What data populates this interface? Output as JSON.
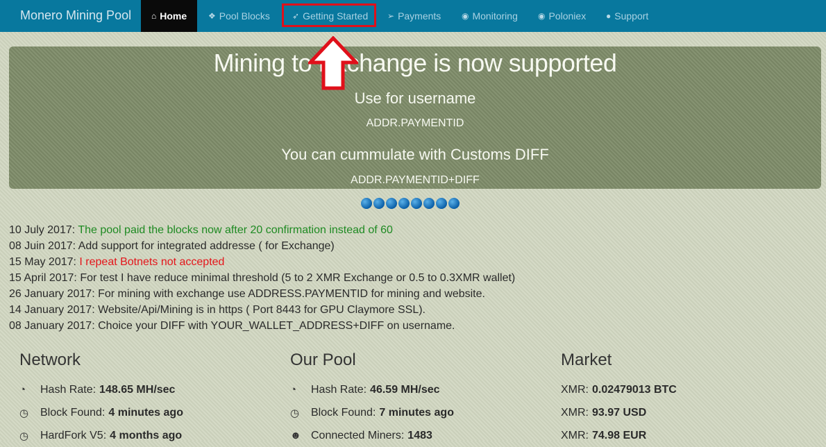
{
  "navbar": {
    "brand": "Monero Mining Pool",
    "items": [
      {
        "label": "Home",
        "icon": "home-icon",
        "glyph": "⌂"
      },
      {
        "label": "Pool Blocks",
        "icon": "cubes-icon",
        "glyph": "❖"
      },
      {
        "label": "Getting Started",
        "icon": "rocket-icon",
        "glyph": "➶"
      },
      {
        "label": "Payments",
        "icon": "send-icon",
        "glyph": "➢"
      },
      {
        "label": "Monitoring",
        "icon": "eye-icon",
        "glyph": "◉"
      },
      {
        "label": "Poloniex",
        "icon": "eye-icon",
        "glyph": "◉"
      },
      {
        "label": "Support",
        "icon": "comments-icon",
        "glyph": "●"
      }
    ],
    "active": "Home",
    "highlighted": "Getting Started"
  },
  "carousel": {
    "title": "Mining to Exchange is now supported",
    "line1": "Use for username",
    "code1": "ADDR.PAYMENTID",
    "line2": "You can cummulate with Customs DIFF",
    "code2": "ADDR.PAYMENTID+DIFF",
    "slide_count": 8
  },
  "news": [
    {
      "date": "10 July 2017:",
      "text": "The pool paid the blocks now after 20 confirmation instead of 60",
      "color": "#1e8a22"
    },
    {
      "date": "08 Juin 2017:",
      "text": "Add support for integrated addresse ( for Exchange)",
      "color": ""
    },
    {
      "date": "15 May 2017:",
      "text": "I repeat Botnets not accepted",
      "color": "#e4161b"
    },
    {
      "date": "15 April 2017:",
      "text": "For test I have reduce minimal threshold (5 to 2 XMR Exchange or 0.5 to 0.3XMR wallet)",
      "color": ""
    },
    {
      "date": "26 January 2017:",
      "text": "For mining with exchange use ADDRESS.PAYMENTID for mining and website.",
      "color": ""
    },
    {
      "date": "14 January 2017:",
      "text": "Website/Api/Mining is in https ( Port 8443 for GPU Claymore SSL).",
      "color": ""
    },
    {
      "date": "08 January 2017:",
      "text": "Choice your DIFF with YOUR_WALLET_ADDRESS+DIFF on username.",
      "color": ""
    }
  ],
  "network": {
    "title": "Network",
    "stats": [
      {
        "label": "Hash Rate:",
        "value": "148.65 MH/sec",
        "icon": "dashboard-icon"
      },
      {
        "label": "Block Found:",
        "value": "4 minutes ago",
        "icon": "clock-icon"
      },
      {
        "label": "HardFork V5:",
        "value": "4 months ago",
        "icon": "clock-icon"
      }
    ]
  },
  "pool": {
    "title": "Our Pool",
    "stats": [
      {
        "label": "Hash Rate:",
        "value": "46.59 MH/sec",
        "icon": "dashboard-icon"
      },
      {
        "label": "Block Found:",
        "value": "7 minutes ago",
        "icon": "clock-icon"
      },
      {
        "label": "Connected Miners:",
        "value": "1483",
        "icon": "users-icon"
      }
    ]
  },
  "market": {
    "title": "Market",
    "stats": [
      {
        "label": "XMR:",
        "value": "0.02479013 BTC"
      },
      {
        "label": "XMR:",
        "value": "93.97 USD"
      },
      {
        "label": "XMR:",
        "value": "74.98 EUR"
      }
    ]
  }
}
